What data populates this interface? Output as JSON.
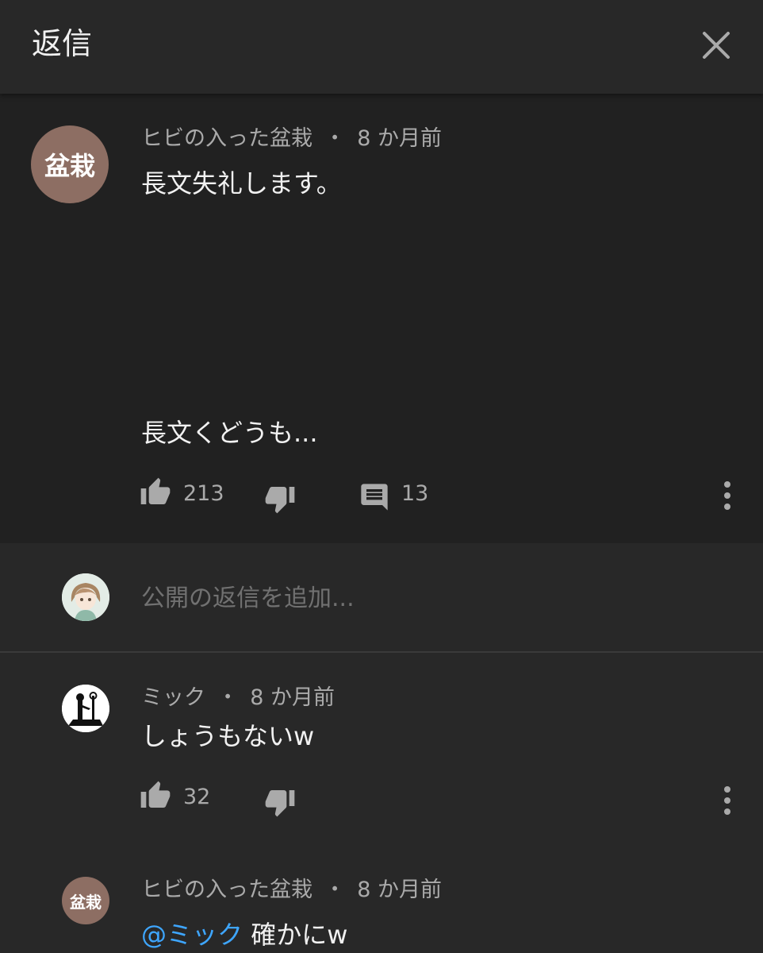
{
  "header": {
    "title": "返信"
  },
  "top_comment": {
    "avatar_text": "盆栽",
    "author": "ヒビの入った盆栽",
    "separator": "・",
    "time": "8 か月前",
    "text_line1": "長文失礼します。",
    "text_line2": "長文くどうも...",
    "likes": "213",
    "replies": "13"
  },
  "add_reply": {
    "placeholder": "公開の返信を追加..."
  },
  "replies": [
    {
      "author": "ミック",
      "separator": "・",
      "time": "8 か月前",
      "text": "しょうもないw",
      "likes": "32"
    },
    {
      "avatar_text": "盆栽",
      "author": "ヒビの入った盆栽",
      "separator": "・",
      "time": "8 か月前",
      "mention": "@ミック",
      "text": "確かにw"
    }
  ],
  "colors": {
    "background": "#282828",
    "highlight_background": "#212121",
    "mention": "#3ea6ff",
    "avatar_brown": "#8d6e63"
  },
  "icons": [
    "close-icon",
    "thumbs-up-icon",
    "thumbs-down-icon",
    "comment-icon",
    "more-vert-icon"
  ]
}
